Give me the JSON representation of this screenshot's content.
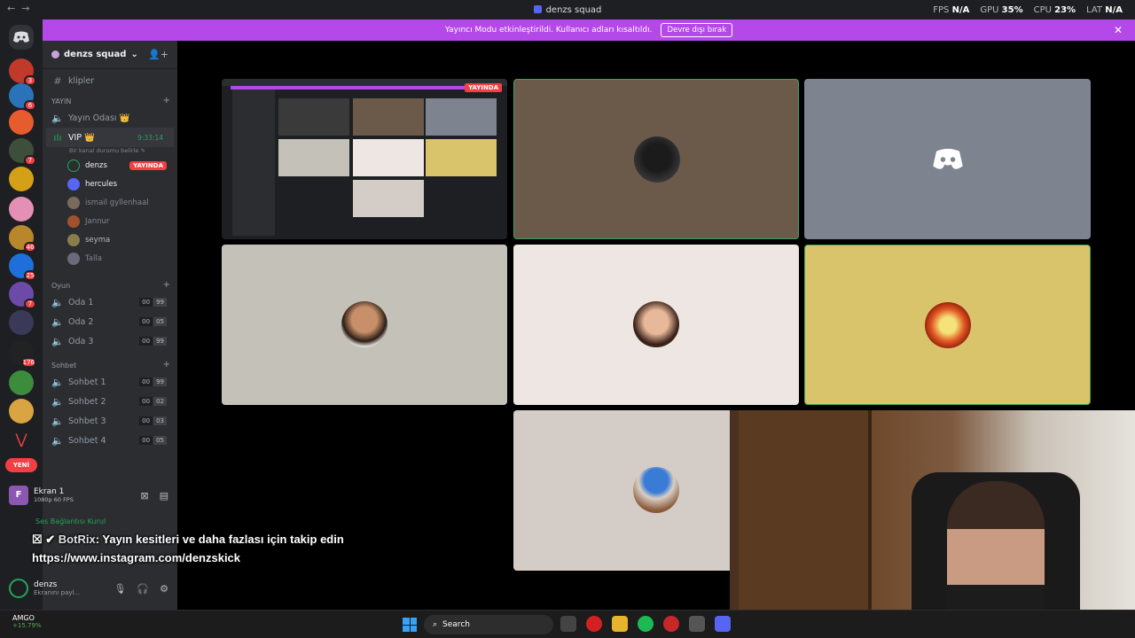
{
  "window": {
    "title": "denzs squad"
  },
  "overlay": {
    "fps_label": "FPS",
    "fps_value": "N/A",
    "gpu_label": "GPU",
    "gpu_value": "35%",
    "cpu_label": "CPU",
    "cpu_value": "23%",
    "lat_label": "LAT",
    "lat_value": "N/A"
  },
  "banner": {
    "text": "Yayıncı Modu etkinleştirildi. Kullanıcı adları kısaltıldı.",
    "button": "Devre dışı bırak"
  },
  "servers": {
    "badges": [
      "3",
      "6",
      "7",
      "46",
      "25",
      "7",
      "176"
    ],
    "new_label": "YENİ"
  },
  "sidebar": {
    "guild_name": "denzs squad",
    "text_channel": "klipler",
    "cat_yayin": "YAYIN",
    "yayin_odasi": "Yayın Odası 👑",
    "vip": "VIP 👑",
    "vip_time": "9:33:14",
    "vip_status": "Bir kanal durumu belirle",
    "members": [
      {
        "name": "denzs",
        "live": "YAYINDA"
      },
      {
        "name": "hercules"
      },
      {
        "name": "ismail gyllenhaal"
      },
      {
        "name": "Jannur"
      },
      {
        "name": "seyma"
      },
      {
        "name": "Talla"
      }
    ],
    "cat_oyun": "Oyun",
    "oyun": [
      {
        "name": "Oda 1",
        "a": "00",
        "b": "99"
      },
      {
        "name": "Oda 2",
        "a": "00",
        "b": "05"
      },
      {
        "name": "Oda 3",
        "a": "00",
        "b": "99"
      }
    ],
    "cat_sohbet": "Sohbet",
    "sohbet": [
      {
        "name": "Sohbet 1",
        "a": "00",
        "b": "99"
      },
      {
        "name": "Sohbet 2",
        "a": "00",
        "b": "02"
      },
      {
        "name": "Sohbet 3",
        "a": "00",
        "b": "03"
      },
      {
        "name": "Sohbet 4",
        "a": "00",
        "b": "05"
      }
    ]
  },
  "stream_panel": {
    "icon": "F",
    "title": "Ekran 1",
    "sub": "1080p 60 FPS"
  },
  "voice": {
    "status": "Ses Bağlantısı Kurul"
  },
  "user": {
    "name": "denzs",
    "status": "Ekranını payl..."
  },
  "stage": {
    "screen_live": "YAYINDA"
  },
  "chat": {
    "username": "BotRix",
    "message": ": Yayın kesitleri ve daha fazlası için takip edin",
    "link": "https://www.instagram.com/denzskick"
  },
  "taskbar": {
    "stock_name": "AMGO",
    "stock_change": "+15.79%",
    "search": "Search"
  },
  "colors": {
    "brand": "#5865f2",
    "streamer_banner": "#b448e8",
    "live": "#f23f43",
    "online": "#23a55a"
  }
}
